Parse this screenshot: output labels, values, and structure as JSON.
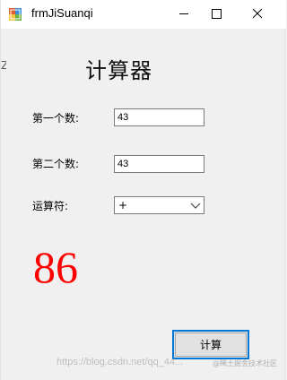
{
  "window": {
    "title": "frmJiSuanqi",
    "icon": "winforms-app-icon",
    "controls": [
      "minimize-icon",
      "maximize-icon",
      "close-icon"
    ]
  },
  "side_glyph": "Z",
  "app_title": "计算器",
  "form": {
    "first_number": {
      "label": "第一个数:",
      "value": "43"
    },
    "second_number": {
      "label": "第二个数:",
      "value": "43"
    },
    "operator": {
      "label": "运算符:",
      "value": "+"
    }
  },
  "result": "86",
  "calculate_button": "计算",
  "watermark": {
    "main": "https://blog.csdn.net/qq_44...",
    "badge": "@稀土掘金技术社区"
  },
  "colors": {
    "result": "#ff0000",
    "button_border": "#0078d7"
  }
}
